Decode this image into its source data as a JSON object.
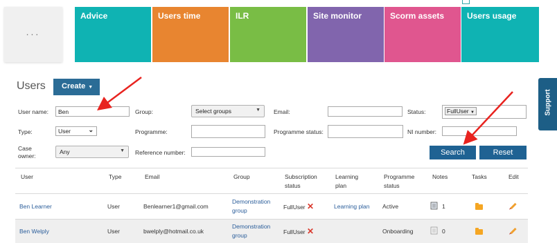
{
  "menu": {
    "dots": "...",
    "tiles": [
      {
        "label": "Advice",
        "color": "#0fb3b3"
      },
      {
        "label": "Users time",
        "color": "#e88530"
      },
      {
        "label": "ILR",
        "color": "#79bd45"
      },
      {
        "label": "Site monitor",
        "color": "#8165ad"
      },
      {
        "label": "Scorm assets",
        "color": "#e0568f"
      },
      {
        "label": "Users usage",
        "color": "#0fb3b3"
      }
    ]
  },
  "support_tab": {
    "label": "Support",
    "color": "#1d5e86"
  },
  "header": {
    "title": "Users",
    "create_label": "Create",
    "create_icon": "caret-down-icon"
  },
  "filters": {
    "user_name": {
      "label": "User name:",
      "value": "Ben"
    },
    "group": {
      "label": "Group:",
      "value": "Select groups"
    },
    "email": {
      "label": "Email:",
      "value": ""
    },
    "status": {
      "label": "Status:",
      "value": "FullUser"
    },
    "type": {
      "label": "Type:",
      "value": "User"
    },
    "programme": {
      "label": "Programme:",
      "value": ""
    },
    "programme_status": {
      "label": "Programme status:",
      "value": ""
    },
    "ni_number": {
      "label": "NI number:",
      "value": ""
    },
    "case_owner": {
      "label": "Case owner:",
      "value": "Any"
    },
    "reference_number": {
      "label": "Reference number:",
      "value": ""
    },
    "search_label": "Search",
    "reset_label": "Reset"
  },
  "table": {
    "columns": [
      "User",
      "Type",
      "Email",
      "Group",
      "Subscription status",
      "Learning plan",
      "Programme status",
      "Notes",
      "Tasks",
      "Edit"
    ],
    "rows": [
      {
        "user": "Ben Learner",
        "type": "User",
        "email": "Benlearner1@gmail.com",
        "group": "Demonstration group",
        "subscription": "FullUser",
        "learning_plan": "Learning plan",
        "programme_status": "Active",
        "notes": "1"
      },
      {
        "user": "Ben Welply",
        "type": "User",
        "email": "bwelply@hotmail.co.uk",
        "group": "Demonstration group",
        "subscription": "FullUser",
        "learning_plan": "",
        "programme_status": "Onboarding",
        "notes": "0"
      }
    ]
  },
  "colors": {
    "accent": "#1f6293",
    "annotation_arrow": "#e8231f"
  }
}
